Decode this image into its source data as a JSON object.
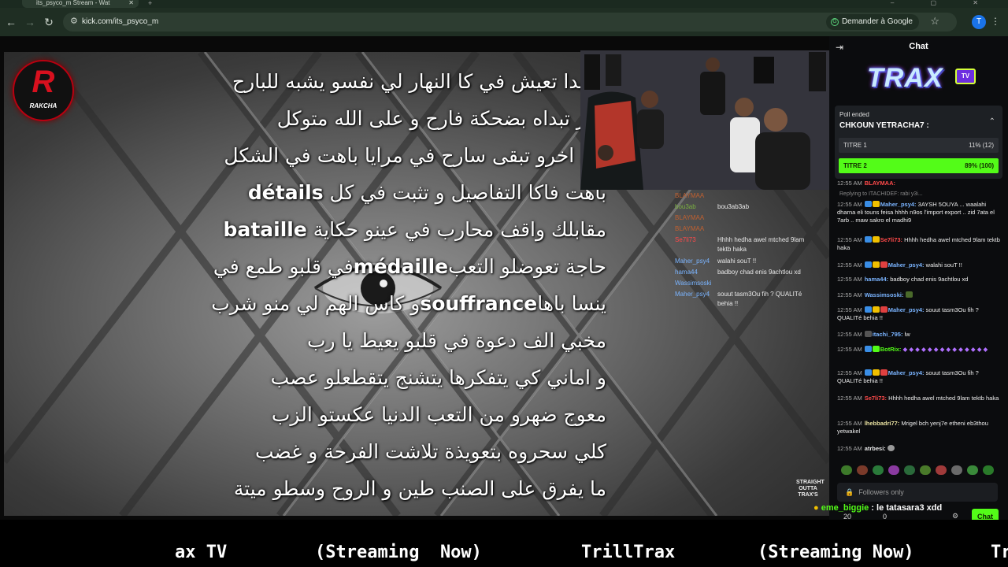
{
  "browser": {
    "tab_title": "its_psyco_m Stream - Wat",
    "url": "kick.com/its_psyco_m",
    "google_btn": "Demander à Google",
    "profile_initial": "T"
  },
  "overlay": {
    "logo_letter": "R",
    "logo_text": "RAKCHA",
    "sticker": "STRAIGHT OUTTA TRAX'S"
  },
  "lyrics": [
    {
      "pre": "و تبدا تعيش في كا النهار لي نفسو يشبه للبارح",
      "bold": "",
      "post": ""
    },
    {
      "pre": "نهار تبداه بضحكة فارح و على الله متوكل",
      "bold": "",
      "post": ""
    },
    {
      "pre": "في اخرو تبقى سارح في مرايا باهت في الشكل",
      "bold": "",
      "post": ""
    },
    {
      "pre": "باهت فاكا التفاصيل و تثبت في كل ",
      "bold": "détails",
      "post": ""
    },
    {
      "pre": "مقابلك واقف محارب في عينو حكاية ",
      "bold": "bataille",
      "post": ""
    },
    {
      "pre": "في قلبو طمع في ",
      "bold": "médaille",
      "post": "حاجة تعوضلو التعب"
    },
    {
      "pre": "ينسا باها",
      "bold": "souffrance",
      "post": "و كاس الهم لي منو شرب"
    },
    {
      "pre": "مخبي الف دعوة في قلبو يعيط يا رب",
      "bold": "",
      "post": ""
    },
    {
      "pre": "و اماني كي يتفكرها يتشنج يتقطعلو عصب",
      "bold": "",
      "post": ""
    },
    {
      "pre": "معوج ضهرو من التعب الدنيا عكستو الزب",
      "bold": "",
      "post": ""
    },
    {
      "pre": "كلي سحروه بتعويذة تلاشت الفرحة و غضب",
      "bold": "",
      "post": ""
    },
    {
      "pre": "ما يفرق على الصنب طين و الروح وسطو ميتة",
      "bold": "",
      "post": ""
    }
  ],
  "ghost_chat": [
    {
      "user": "BLAYMAA",
      "text": ""
    },
    {
      "user": "bou3ab",
      "text": "bou3ab3ab"
    },
    {
      "user": "BLAYMAA",
      "text": ""
    },
    {
      "user": "BLAYMAA",
      "text": ""
    },
    {
      "user": "Se7li73",
      "text": "Hhhh hedha awel mtched 9lam"
    },
    {
      "user": "",
      "text": "tektb haka"
    },
    {
      "user": "Maher_psy4",
      "text": "walahi souT !!"
    },
    {
      "user": "hama44",
      "text": "badboy chad enis 9achtlou xd"
    },
    {
      "user": "Wassimsoski",
      "text": ""
    },
    {
      "user": "Maher_psy4",
      "text": "souut tasm3Ou fih ? QUALITé"
    },
    {
      "user": "",
      "text": "behia !!"
    }
  ],
  "chat": {
    "title": "Chat",
    "brand": "TRAX",
    "brand_tv": "TV",
    "poll": {
      "status": "Poll ended",
      "question": "CHKOUN YETRACHA7 :",
      "options": [
        {
          "label": "TITRE 1",
          "result": "11% (12)",
          "fraction": 0.11
        },
        {
          "label": "TITRE 2",
          "result": "89% (100)",
          "fraction": 0.89
        }
      ]
    },
    "reply_hint": "Replying to ITACHIDEF:",
    "reply_suffix": "rabi y3i...",
    "messages": [
      {
        "time": "12:55 AM",
        "user": "BLAYMAA:",
        "text": "",
        "color": "#ff4a4a"
      },
      {
        "time": "12:55 AM",
        "user": "Maher_psy4:",
        "text": "3AYSH 5OUYA ... waalahi dharna eli touns feisa hhhh n9os l'import export .. zid 7ata el 7arb .. maw sakro el madhi9",
        "color": "#7ab4ff"
      },
      {
        "time": "12:55 AM",
        "user": "Se7li73:",
        "text": "Hhhh hedha awel mtched 9lam tektb haka",
        "color": "#ff4a4a"
      },
      {
        "time": "12:55 AM",
        "user": "Maher_psy4:",
        "text": "walahi souT !!",
        "color": "#7ab4ff"
      },
      {
        "time": "12:55 AM",
        "user": "hama44:",
        "text": "badboy chad enis 9achtlou xd",
        "color": "#7ab4ff"
      },
      {
        "time": "12:55 AM",
        "user": "Wassimsoski:",
        "text": "",
        "color": "#7ab4ff"
      },
      {
        "time": "12:55 AM",
        "user": "Maher_psy4:",
        "text": "souut tasm3Ou fih ? QUALITé behia !!",
        "color": "#7ab4ff"
      },
      {
        "time": "12:55 AM",
        "user": "itachi_795:",
        "text": "lw",
        "color": "#7ab4ff"
      },
      {
        "time": "12:55 AM",
        "user": "BotRix:",
        "text": "",
        "color": "#53fc18"
      },
      {
        "time": "12:55 AM",
        "user": "Maher_psy4:",
        "text": "souut tasm3Ou fih ? QUALITé behia !!",
        "color": "#7ab4ff"
      },
      {
        "time": "12:55 AM",
        "user": "Se7li73:",
        "text": "Hhhh hedha awel mtched 9lam tektb haka",
        "color": "#ff4a4a"
      },
      {
        "time": "12:55 AM",
        "user": "lhebbadri77:",
        "text": "Mrigel bch yenj7e etheni eb3thou yetwakel",
        "color": "#e8e0a0"
      },
      {
        "time": "12:55 AM",
        "user": "atrbesi:",
        "text": "",
        "color": "#e8e8e8"
      }
    ],
    "followers_only": "Followers only",
    "pinned_user": "eme_biggie",
    "pinned_text": " : le tatasara3 xdd",
    "count_points": "20",
    "count_other": "0",
    "send_label": "Chat"
  },
  "ticker": {
    "segments": [
      "ax TV",
      "(Streaming  Now)",
      "TrillTrax",
      "(Streaming Now)",
      "Tr"
    ]
  },
  "colors": {
    "kick_green": "#53fc18",
    "browser_bg": "#1f2e23"
  }
}
